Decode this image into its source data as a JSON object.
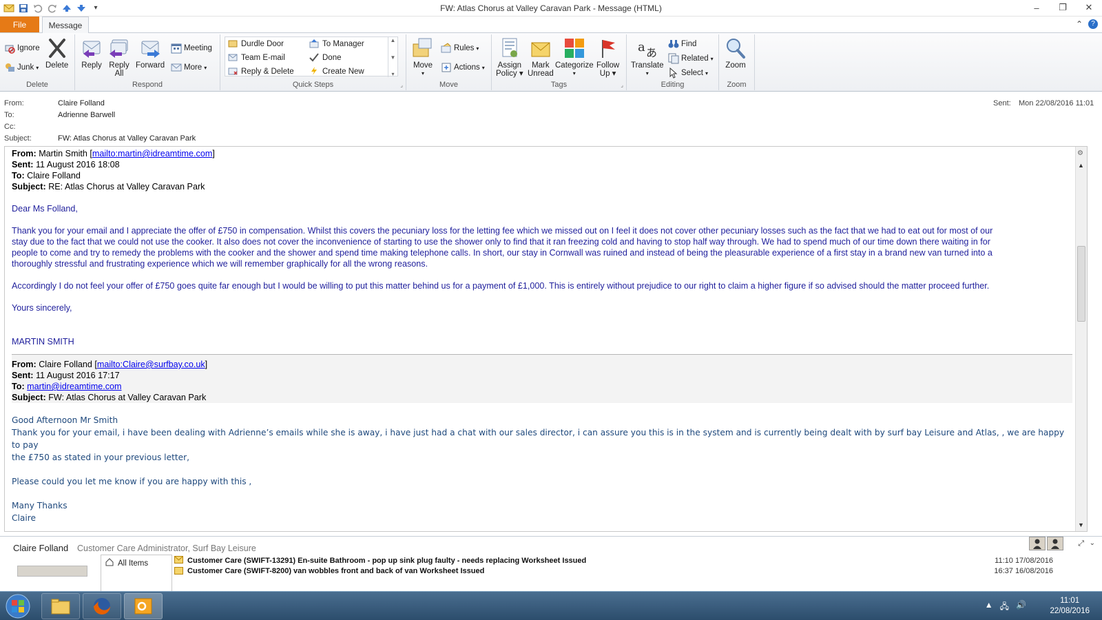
{
  "window": {
    "title": "FW: Atlas Chorus at Valley Caravan Park  -  Message (HTML)"
  },
  "tabs": {
    "file": "File",
    "message": "Message"
  },
  "ribbon": {
    "delete": {
      "ignore": "Ignore",
      "junk": "Junk",
      "delete": "Delete",
      "label": "Delete"
    },
    "respond": {
      "reply": "Reply",
      "reply_all_1": "Reply",
      "reply_all_2": "All",
      "forward": "Forward",
      "meeting": "Meeting",
      "more": "More",
      "label": "Respond"
    },
    "quick_steps": {
      "items": [
        "Durdle Door",
        "Team E-mail",
        "Reply & Delete",
        "To Manager",
        "Done",
        "Create New"
      ],
      "label": "Quick Steps"
    },
    "move": {
      "move": "Move",
      "rules": "Rules",
      "actions": "Actions",
      "label": "Move"
    },
    "tags": {
      "assign_1": "Assign",
      "assign_2": "Policy",
      "mark_1": "Mark",
      "mark_2": "Unread",
      "categorize": "Categorize",
      "follow_1": "Follow",
      "follow_2": "Up",
      "label": "Tags"
    },
    "editing": {
      "translate": "Translate",
      "find": "Find",
      "related": "Related",
      "select": "Select",
      "label": "Editing"
    },
    "zoom": {
      "zoom": "Zoom",
      "label": "Zoom"
    }
  },
  "header": {
    "from_label": "From:",
    "from": "Claire Folland",
    "to_label": "To:",
    "to": "Adrienne Barwell",
    "cc_label": "Cc:",
    "subject_label": "Subject:",
    "subject": "FW: Atlas Chorus at Valley Caravan Park",
    "sent_label": "Sent:",
    "sent": "Mon 22/08/2016 11:01"
  },
  "message1": {
    "from_label": "From:",
    "from_name": "Martin Smith [",
    "from_link": "mailto:martin@idreamtime.com",
    "from_close": "]",
    "sent_label": "Sent:",
    "sent": "11 August 2016 18:08",
    "to_label": "To:",
    "to": "Claire Folland",
    "subject_label": "Subject:",
    "subject": "RE: Atlas Chorus at Valley Caravan Park",
    "greeting": "Dear Ms Folland,",
    "para1_l1": "Thank you for your email and I appreciate the offer of £750 in compensation.  Whilst this covers the pecuniary loss for the letting fee which we missed out on I feel it does not cover other pecuniary losses such as the fact that we had to eat out for most of our",
    "para1_l2": "stay due to the fact that we could not use the cooker.  It also does not cover the inconvenience of starting to use the shower only to find that it ran freezing cold and having to stop half way through.  We had to spend much of our time down there waiting in for",
    "para1_l3": "people to come and try to remedy the problems with the cooker and the shower and spend time making telephone calls.  In short, our stay in Cornwall was ruined and instead of being the pleasurable experience of a first stay in a brand new van turned into a",
    "para1_l4": "thoroughly stressful and frustrating experience which we will remember graphically for all the wrong reasons.",
    "para2": "Accordingly I do not feel your offer of £750 goes quite far enough but I would be willing to put this matter behind us for a payment of £1,000.  This is entirely without prejudice to our right to claim a higher figure if so advised should the matter proceed further.",
    "closing": "Yours sincerely,",
    "signature": "MARTIN SMITH"
  },
  "message2": {
    "from_label": "From:",
    "from_name": "Claire Folland [",
    "from_link": "mailto:Claire@surfbay.co.uk",
    "from_close": "]",
    "sent_label": "Sent:",
    "sent": "11 August 2016 17:17",
    "to_label": "To:",
    "to_link": "martin@idreamtime.com",
    "subject_label": "Subject:",
    "subject": "FW: Atlas Chorus at Valley Caravan Park",
    "greeting": "Good Afternoon Mr Smith",
    "body_l1": "Thank you for your email, i have been dealing with Adrienne’s emails while she is away, i have just had a chat with our sales director, i can assure you this is in the system and is currently being dealt with by surf bay Leisure and Atlas, , we are happy to pay",
    "body_l2": "the £750 as stated in your previous letter,",
    "body_l3": "Please could you let me know if you are happy with this ,",
    "thanks": "Many Thanks",
    "name": "Claire"
  },
  "people_pane": {
    "name": "Claire Folland",
    "title": "Customer Care Administrator, Surf Bay Leisure",
    "tree_item": "All Items",
    "rows": [
      {
        "subject": "Customer Care (SWIFT-13291) En-suite Bathroom - pop up sink plug faulty - needs replacing Worksheet Issued",
        "date": "11:10  17/08/2016"
      },
      {
        "subject": "Customer Care (SWIFT-8200) van wobbles front and back of van Worksheet Issued",
        "date": "16:37  16/08/2016"
      }
    ]
  },
  "taskbar": {
    "time": "11:01",
    "date": "22/08/2016"
  },
  "colors": {
    "file_tab": "#e67a16",
    "body_blue": "#1f1f9c",
    "reply_blue": "#1f497d",
    "link": "#0000ee"
  }
}
